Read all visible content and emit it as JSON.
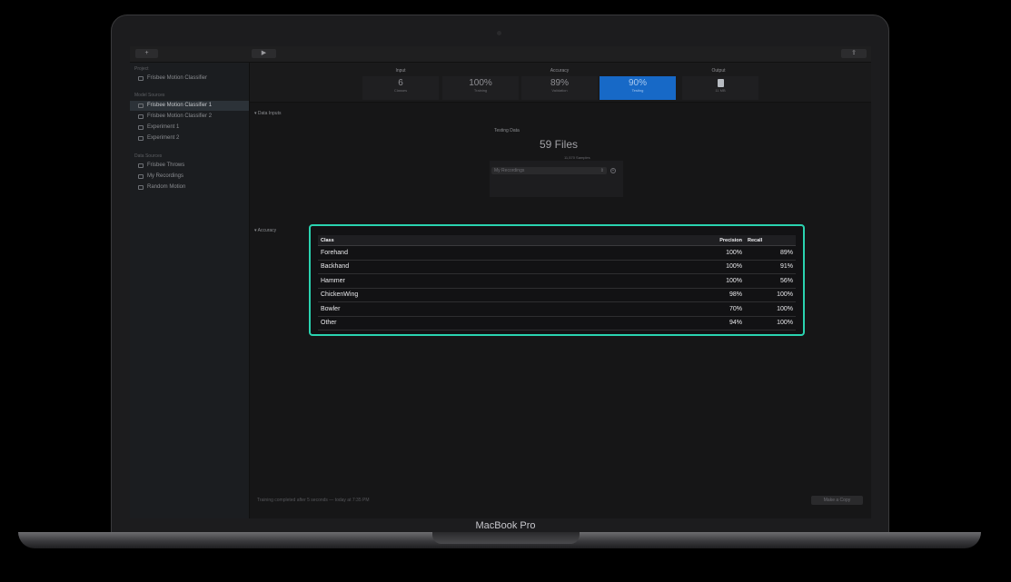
{
  "device": {
    "brand": "MacBook Pro"
  },
  "toolbar": {
    "back_symbol": "+",
    "play_symbol": "▶",
    "share_symbol": "⇪"
  },
  "sidebar": {
    "project_heading": "Project",
    "project_name": "Frisbee Motion Classifier",
    "model_sources_heading": "Model Sources",
    "model_sources": [
      {
        "label": "Frisbee Motion Classifier 1",
        "selected": true
      },
      {
        "label": "Frisbee Motion Classifier 2",
        "selected": false
      },
      {
        "label": "Experiment 1",
        "selected": false
      },
      {
        "label": "Experiment 2",
        "selected": false
      }
    ],
    "data_sources_heading": "Data Sources",
    "data_sources": [
      {
        "label": "Frisbee Throws"
      },
      {
        "label": "My Recordings"
      },
      {
        "label": "Random Motion"
      }
    ]
  },
  "summary": {
    "input_heading": "Input",
    "accuracy_heading": "Accuracy",
    "output_heading": "Output",
    "classes": {
      "value": "6",
      "label": "Classes"
    },
    "training": {
      "value": "100%",
      "label": "Training"
    },
    "validation": {
      "value": "89%",
      "label": "Validation"
    },
    "testing": {
      "value": "90%",
      "label": "Testing"
    },
    "output": {
      "icon": "document-icon",
      "label": "11 MB"
    }
  },
  "data_inputs": {
    "section_label": "▾ Data Inputs",
    "testing_title": "Testing Data",
    "files": "59 Files",
    "samples": "11,570 Samples",
    "dataset": "My Recordings",
    "dataset_arrows": "⇕"
  },
  "accuracy": {
    "section_label": "▾ Accuracy",
    "columns": [
      "Class",
      "Precision",
      "Recall"
    ],
    "rows": [
      {
        "class": "Forehand",
        "precision": "100%",
        "recall": "89%"
      },
      {
        "class": "Backhand",
        "precision": "100%",
        "recall": "91%"
      },
      {
        "class": "Hammer",
        "precision": "100%",
        "recall": "56%"
      },
      {
        "class": "ChickenWing",
        "precision": "98%",
        "recall": "100%"
      },
      {
        "class": "Bowler",
        "precision": "70%",
        "recall": "100%"
      },
      {
        "class": "Other",
        "precision": "94%",
        "recall": "100%"
      }
    ]
  },
  "status": {
    "text": "Training completed after 5 seconds — today at 7:35 PM",
    "copy_button": "Make a Copy"
  },
  "colors": {
    "highlight_border": "#2ad3b0",
    "testing_tile": "#1769c7"
  }
}
